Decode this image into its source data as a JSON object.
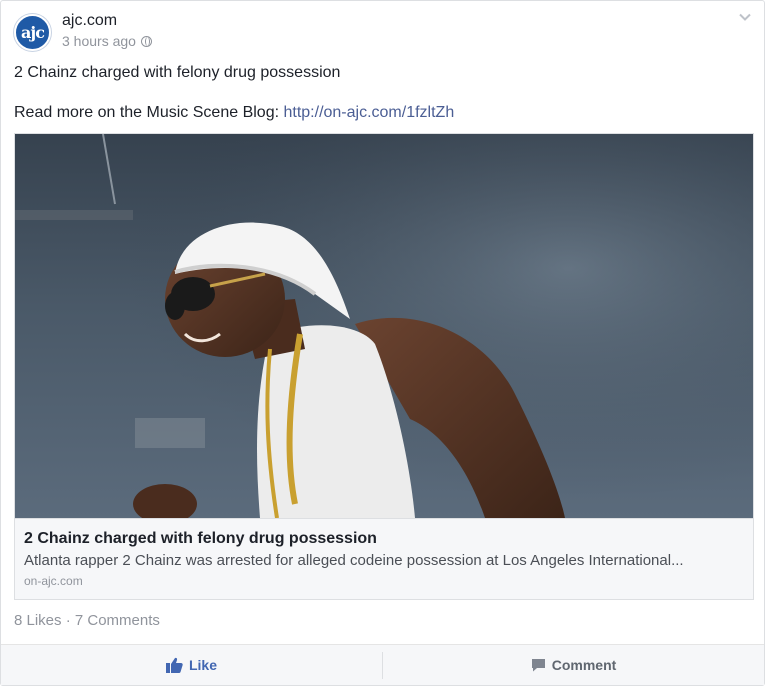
{
  "post": {
    "page_name": "ajc.com",
    "avatar_text": "ajc",
    "timestamp": "3 hours ago",
    "headline": "2 Chainz charged with felony drug possession",
    "read_more_prefix": "Read more on the Music Scene Blog: ",
    "read_more_link": "http://on-ajc.com/1fzltZh"
  },
  "link_card": {
    "title": "2 Chainz charged with felony drug possession",
    "description": "Atlanta rapper 2 Chainz was arrested for alleged codeine possession at Los Angeles International...",
    "domain": "on-ajc.com"
  },
  "stats": {
    "likes": "8 Likes",
    "separator": "·",
    "comments": "7 Comments"
  },
  "actions": {
    "like_label": "Like",
    "comment_label": "Comment"
  },
  "icons": {
    "menu": "chevron-down-icon",
    "privacy": "globe-icon",
    "like": "thumbs-up-icon",
    "comment": "speech-bubble-icon"
  },
  "colors": {
    "link": "#4b5e94",
    "like_accent": "#4267b2",
    "avatar_bg": "#1f5aa6",
    "muted": "#90949c"
  }
}
